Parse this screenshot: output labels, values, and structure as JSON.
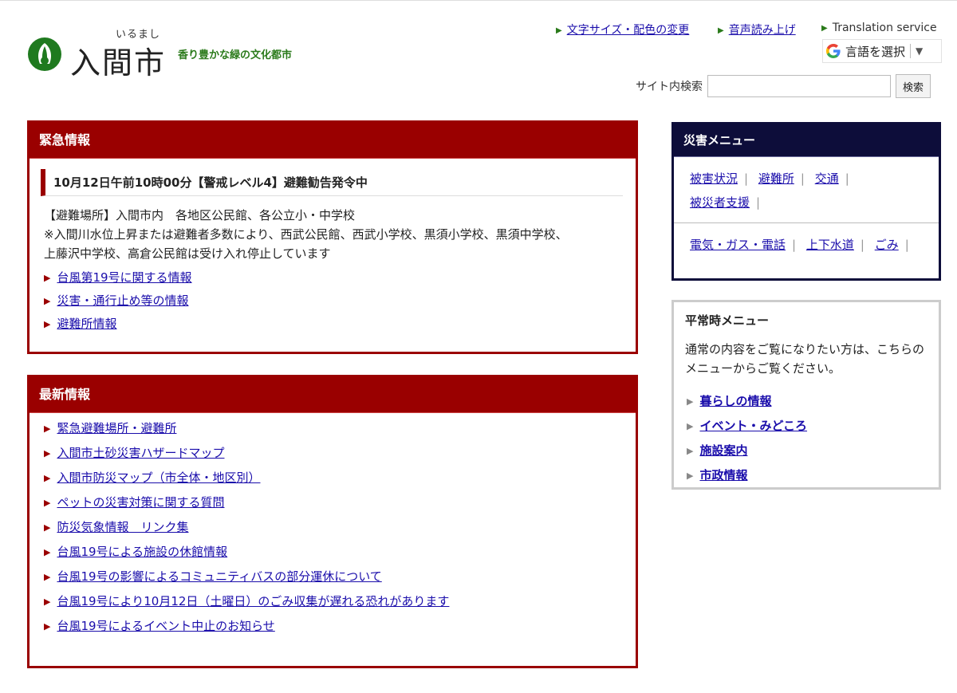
{
  "header": {
    "logo_ruby": "いるまし",
    "logo_name": "入間市",
    "tagline": "香り豊かな緑の文化都市",
    "utility_links": [
      "文字サイズ・配色の変更",
      "音声読み上げ"
    ],
    "translation_label": "Translation service",
    "translate_select": "言語を選択",
    "search_label": "サイト内検索",
    "search_value": "",
    "search_button": "検索"
  },
  "emergency": {
    "heading": "緊急情報",
    "alert_title": "10月12日午前10時00分【警戒レベル4】避難勧告発令中",
    "body_lines": [
      "【避難場所】入間市内　各地区公民館、各公立小・中学校",
      "※入間川水位上昇または避難者多数により、西武公民館、西武小学校、黒須小学校、黒須中学校、",
      "上藤沢中学校、高倉公民館は受け入れ停止しています"
    ],
    "links": [
      "台風第19号に関する情報",
      "災害・通行止め等の情報",
      "避難所情報"
    ]
  },
  "latest": {
    "heading": "最新情報",
    "links": [
      "緊急避難場所・避難所",
      "入間市土砂災害ハザードマップ",
      "入間市防災マップ（市全体・地区別）",
      "ペットの災害対策に関する質問",
      "防災気象情報　リンク集",
      "台風19号による施設の休館情報",
      "台風19号の影響によるコミュニティバスの部分運休について",
      "台風19号により10月12日（土曜日）のごみ収集が遅れる恐れがあります",
      "台風19号によるイベント中止のお知らせ"
    ]
  },
  "disaster_menu": {
    "heading": "災害メニュー",
    "row1": [
      "被害状況",
      "避難所",
      "交通",
      "被災者支援"
    ],
    "row2": [
      "電気・ガス・電話",
      "上下水道",
      "ごみ"
    ]
  },
  "normal_menu": {
    "heading": "平常時メニュー",
    "description": "通常の内容をご覧になりたい方は、こちらのメニューからご覧ください。",
    "links": [
      "暮らしの情報",
      "イベント・みどころ",
      "施設案内",
      "市政情報"
    ]
  },
  "colors": {
    "emergency_red": "#9a0000",
    "disaster_navy": "#0d0d3a",
    "tagline_green": "#2a7a1a"
  }
}
